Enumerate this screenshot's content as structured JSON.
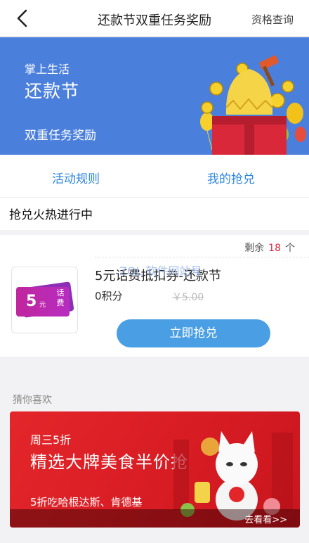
{
  "nav": {
    "title": "还款节双重任务奖励",
    "action": "资格查询"
  },
  "banner": {
    "subtitle": "掌上生活",
    "title": "还款节",
    "description": "双重任务奖励",
    "bg_color": "#4b7fdc"
  },
  "tabs": [
    {
      "label": "活动规则"
    },
    {
      "label": "我的抢兑"
    }
  ],
  "section": {
    "title": "抢兑火热进行中"
  },
  "product": {
    "remaining_prefix": "剩余",
    "remaining_count": "18",
    "remaining_suffix": "个",
    "coupon_amount": "5",
    "coupon_unit": "元",
    "coupon_tag": "话费",
    "name": "5元话费抵扣券-还款节",
    "points": "0积分",
    "original_price": "￥5.00",
    "button_label": "立即抢兑"
  },
  "recommend": {
    "label": "猜你喜欢",
    "subtitle": "周三5折",
    "title": "精选大牌美食半价抢",
    "description": "5折吃哈根达斯、肯德基",
    "more": "去看看>>",
    "bg_color": "#d71b23"
  },
  "watermark": "ZOL 软件网站号"
}
